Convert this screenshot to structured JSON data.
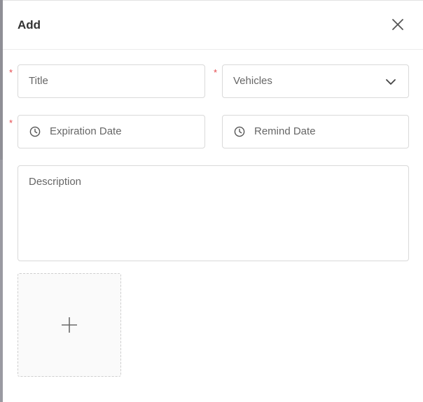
{
  "modal": {
    "title": "Add"
  },
  "form": {
    "title_placeholder": "Title",
    "vehicles_placeholder": "Vehicles",
    "expiration_placeholder": "Expiration Date",
    "remind_placeholder": "Remind Date",
    "description_placeholder": "Description",
    "required_mark": "*"
  },
  "icons": {
    "close": "close-icon",
    "dropdown": "chevron-down-icon",
    "clock": "clock-icon",
    "upload": "plus-icon"
  },
  "colors": {
    "required": "#e5484d",
    "border": "#d9d9d9",
    "placeholder": "#666666"
  }
}
